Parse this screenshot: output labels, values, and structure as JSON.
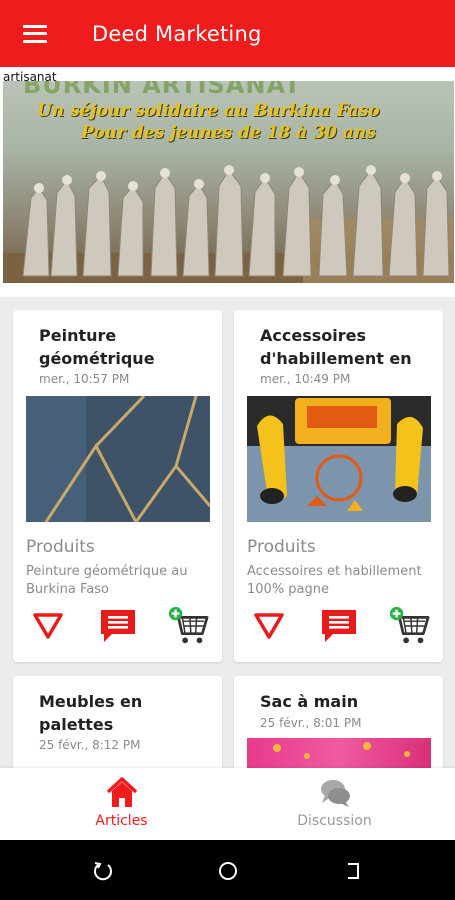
{
  "appbar": {
    "title": "Deed Marketing",
    "color": "#ee1c1c"
  },
  "banner": {
    "caption": "artisanat",
    "heading": "BURKIN ARTISANAT",
    "line1": "Un séjour solidaire au Burkina Faso",
    "line2": "Pour des jeunes de 18 à 30 ans"
  },
  "cards": [
    {
      "title": "Peinture géométrique",
      "time": "mer., 10:57 PM",
      "category": "Produits",
      "description": "Peinture géométrique au Burkina Faso"
    },
    {
      "title": "Accessoires d'habillement en",
      "time": "mer., 10:49 PM",
      "category": "Produits",
      "description": "Accessoires et habillement 100% pagne"
    },
    {
      "title": "Meubles en palettes",
      "time": "25 févr., 8:12 PM"
    },
    {
      "title": "Sac à main",
      "time": "25 févr., 8:01 PM"
    }
  ],
  "icons": {
    "dislike": "triangle-down-icon",
    "comment": "comment-icon",
    "cart": "add-to-cart-icon"
  },
  "bottom_nav": {
    "items": [
      {
        "label": "Articles",
        "icon": "home-icon",
        "active": true
      },
      {
        "label": "Discussion",
        "icon": "chat-icon",
        "active": false
      }
    ],
    "active_color": "#ee1c1c",
    "inactive_color": "#9a9a9a"
  },
  "system_nav": {
    "buttons": [
      "recents-icon",
      "home-circle-icon",
      "back-icon"
    ]
  }
}
